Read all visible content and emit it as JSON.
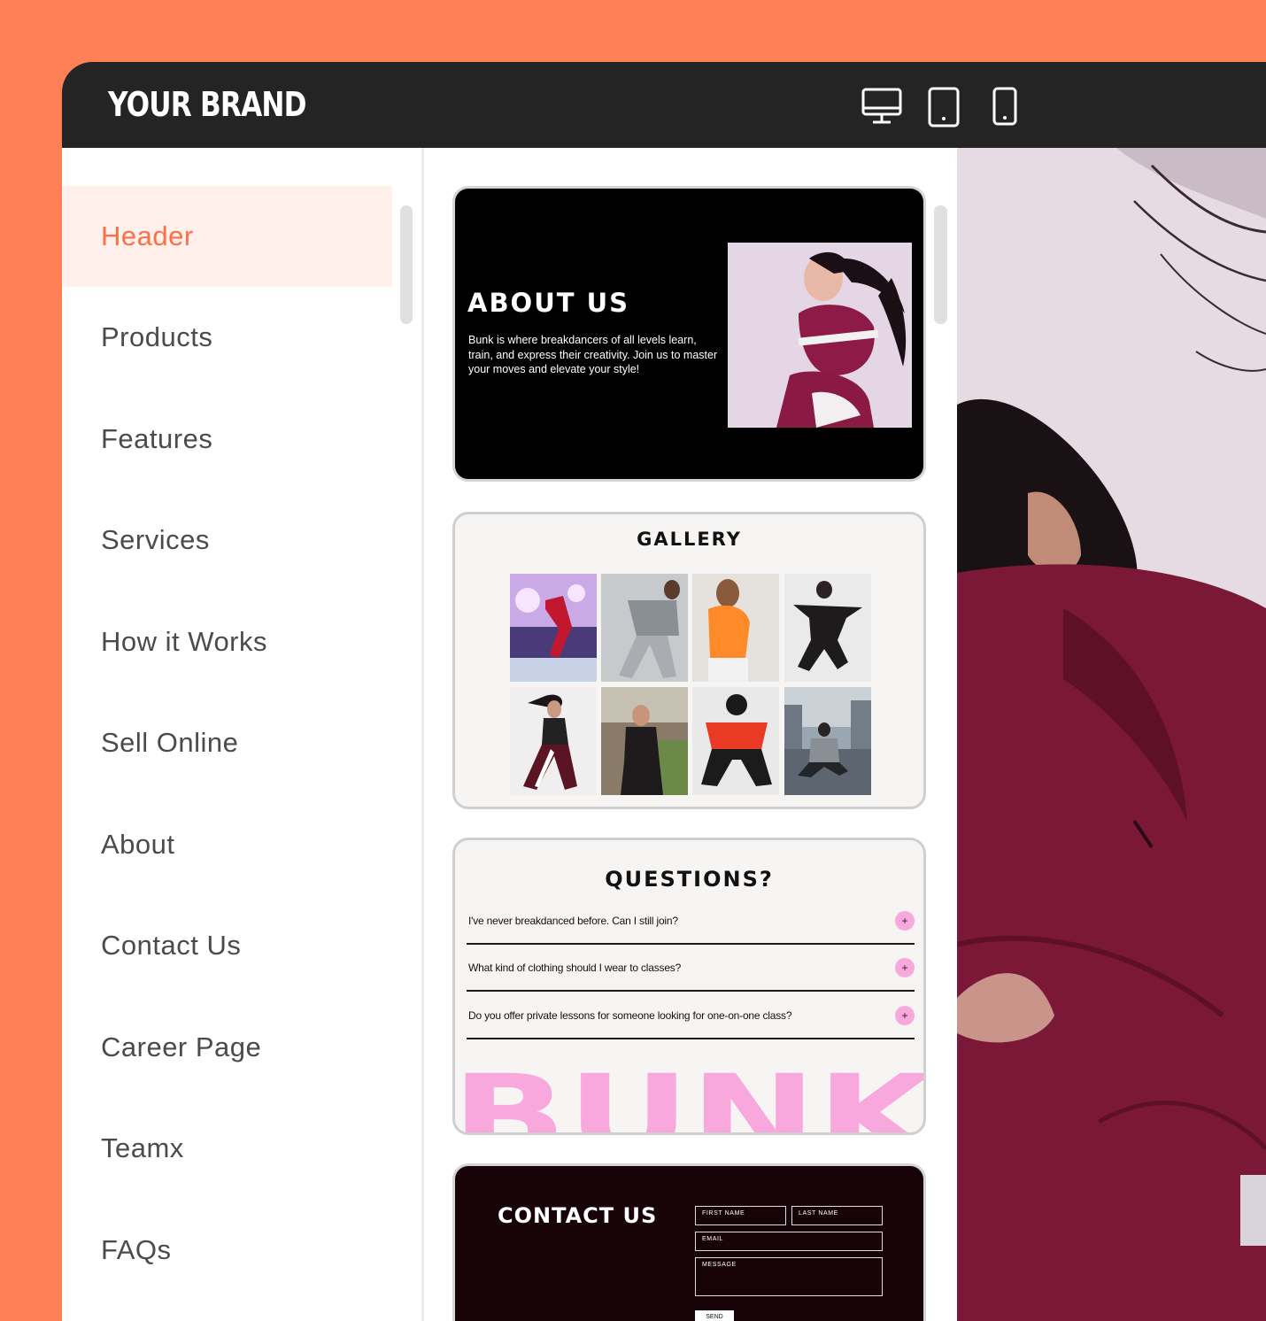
{
  "colors": {
    "accent": "#ff7f57",
    "topbar": "#242424",
    "active_bg": "#fff0ec",
    "active_text": "#ff6f46",
    "bunk_pink": "#f8a8dc"
  },
  "header": {
    "brand": "YOUR BRAND",
    "devices": [
      "desktop-icon",
      "tablet-icon",
      "mobile-icon"
    ]
  },
  "sidebar": {
    "items": [
      {
        "label": "Header",
        "active": true
      },
      {
        "label": "Products"
      },
      {
        "label": "Features"
      },
      {
        "label": "Services"
      },
      {
        "label": "How it Works"
      },
      {
        "label": "Sell Online"
      },
      {
        "label": "About"
      },
      {
        "label": "Contact Us"
      },
      {
        "label": "Career Page"
      },
      {
        "label": "Teamx"
      },
      {
        "label": "FAQs"
      }
    ]
  },
  "previews": {
    "about": {
      "title": "ABOUT US",
      "body": "Bunk is where breakdancers of all levels learn, train, and express their creativity. Join us to master your moves and elevate your style!"
    },
    "gallery": {
      "title": "GALLERY"
    },
    "faq": {
      "title": "QUESTIONS?",
      "questions": [
        "I've never breakdanced before. Can I still join?",
        "What kind of clothing should I wear to classes?",
        "Do you offer private lessons for someone looking for one-on-one class?"
      ],
      "plus": "+",
      "brand_word": "BUNK"
    },
    "contact": {
      "title": "CONTACT US",
      "fields": {
        "first_name": "FIRST NAME",
        "last_name": "LAST NAME",
        "email": "EMAIL",
        "message": "MESSAGE"
      },
      "send": "SEND"
    }
  }
}
